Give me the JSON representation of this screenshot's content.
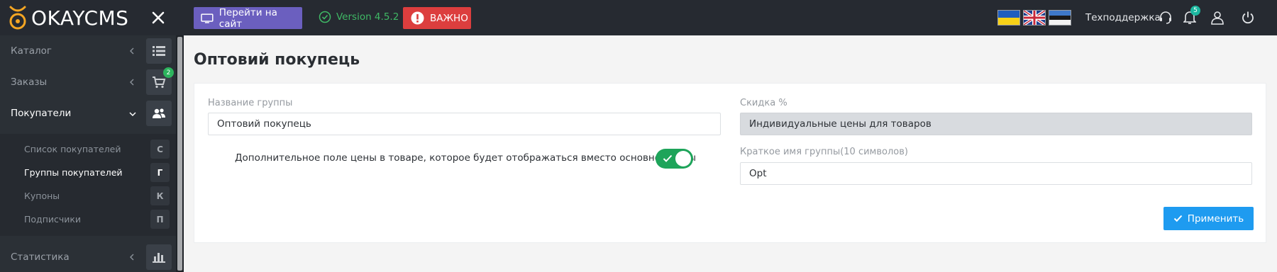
{
  "brand": {
    "logo_okay": "OKAY",
    "logo_cms": "CMS"
  },
  "sidebar": {
    "items": [
      {
        "label": "Каталог",
        "icon": "list-icon"
      },
      {
        "label": "Заказы",
        "icon": "cart-icon",
        "badge": "2"
      },
      {
        "label": "Покупатели",
        "icon": "users-icon"
      },
      {
        "label": "Статистика",
        "icon": "bar-chart-icon"
      }
    ],
    "submenu": [
      {
        "label": "Список покупателей",
        "letter": "С"
      },
      {
        "label": "Группы покупателей",
        "letter": "Г"
      },
      {
        "label": "Купоны",
        "letter": "К"
      },
      {
        "label": "Подписчики",
        "letter": "П"
      }
    ]
  },
  "topbar": {
    "site_button": "Перейти на сайт",
    "version": "Version 4.5.2",
    "important_button": "ВАЖНО",
    "support": "Техподдержка",
    "notifications_badge": "5",
    "flags": [
      "ukraine-flag",
      "uk-flag",
      "estonia-flag"
    ]
  },
  "page": {
    "title": "Оптовий покупець",
    "group_name_label": "Название группы",
    "group_name_value": "Оптовий покупець",
    "discount_label": "Скидка %",
    "discount_value": "Индивидуальные цены для товаров",
    "toggle_text": "Дополнительное поле цены в товаре, которое будет отображаться вместо основной цены",
    "toggle_state": "on",
    "short_name_label": "Краткое имя группы(10 символов)",
    "short_name_value": "Opt",
    "apply_button": "Применить"
  },
  "colors": {
    "sidebar_bg": "#2b3036",
    "topbar_bg": "#262a31",
    "site_button": "#6b5fbf",
    "important_button": "#dc3e3e",
    "version_text": "#3fb865",
    "toggle_on": "#1ea45a",
    "apply_button": "#1e9bf0"
  }
}
